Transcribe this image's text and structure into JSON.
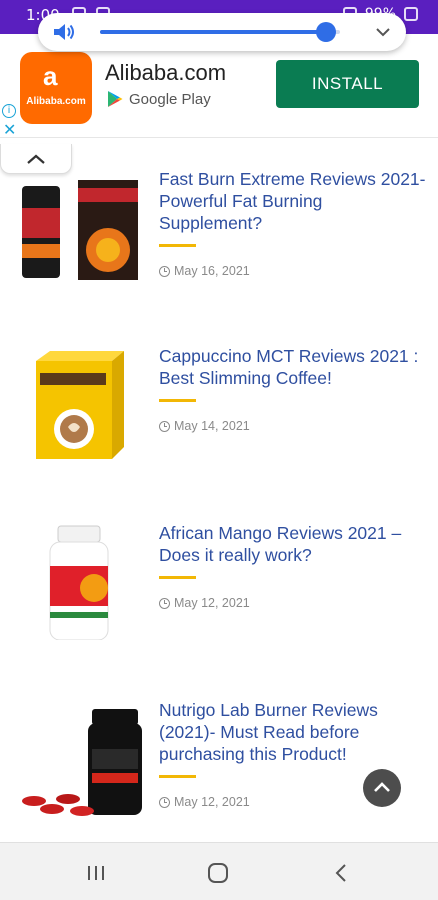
{
  "status_bar": {
    "time": "1:00",
    "battery": "99%"
  },
  "volume": {
    "level_percent": 94
  },
  "ad": {
    "logo_text": "Alibaba.com",
    "title": "Alibaba.com",
    "store": "Google Play",
    "install_label": "INSTALL",
    "info_icon": "info-icon",
    "close_icon": "close-icon"
  },
  "articles": [
    {
      "title": "Fast Burn Extreme Reviews 2021- Powerful Fat Burning Supplement?",
      "date": "May 16, 2021",
      "thumb_color": "#c1272d"
    },
    {
      "title": "Cappuccino MCT Reviews 2021 : Best Slimming Coffee!",
      "date": "May 14, 2021",
      "thumb_color": "#f5c400"
    },
    {
      "title": "African Mango Reviews 2021 – Does it really work?",
      "date": "May 12, 2021",
      "thumb_color": "#e0202a"
    },
    {
      "title": "Nutrigo Lab Burner Reviews (2021)- Must Read before purchasing this Product!",
      "date": "May 12, 2021",
      "thumb_color": "#111111"
    }
  ],
  "colors": {
    "status_bar": "#5a1fbf",
    "title_link": "#2f4fa0",
    "accent": "#f2b705",
    "install_button": "#0a7c52",
    "volume_accent": "#2f6de6"
  }
}
